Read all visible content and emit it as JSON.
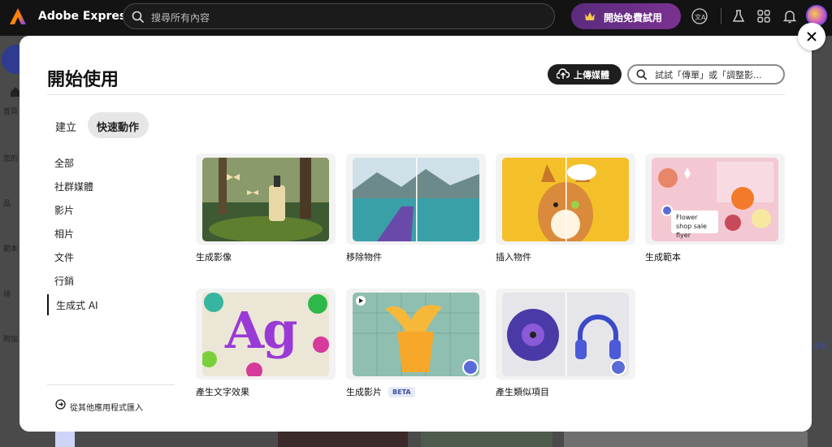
{
  "topbar": {
    "app_name": "Adobe Express",
    "search_placeholder": "搜尋所有內容",
    "trial_label": "開始免費試用"
  },
  "background": {
    "sidebar_labels": [
      "首頁",
      "您的",
      "品",
      "範本",
      "排",
      "附加"
    ],
    "right_fragment": "原效"
  },
  "modal": {
    "title": "開始使用",
    "upload_label": "上傳媒體",
    "search_placeholder": "試試「傳單」或「調整影...",
    "tabs": [
      {
        "label": "建立",
        "selected": false
      },
      {
        "label": "快速動作",
        "selected": true
      }
    ],
    "categories": [
      {
        "label": "全部"
      },
      {
        "label": "社群媒體"
      },
      {
        "label": "影片"
      },
      {
        "label": "相片"
      },
      {
        "label": "文件"
      },
      {
        "label": "行銷"
      },
      {
        "label": "生成式 AI",
        "selected": true
      }
    ],
    "import_label": "從其他應用程式匯入",
    "cards": [
      {
        "label": "生成影像"
      },
      {
        "label": "移除物件"
      },
      {
        "label": "插入物件"
      },
      {
        "label": "生成範本",
        "thumb_text": "Flower shop sale flyer"
      },
      {
        "label": "產生文字效果",
        "thumb_text": "Ag"
      },
      {
        "label": "生成影片",
        "badge": "BETA"
      },
      {
        "label": "產生類似項目"
      }
    ]
  },
  "colors": {
    "topbar_bg": "#131313",
    "trial_gradient": "#6a2f86",
    "accent_ai": "#5a6bd8"
  }
}
